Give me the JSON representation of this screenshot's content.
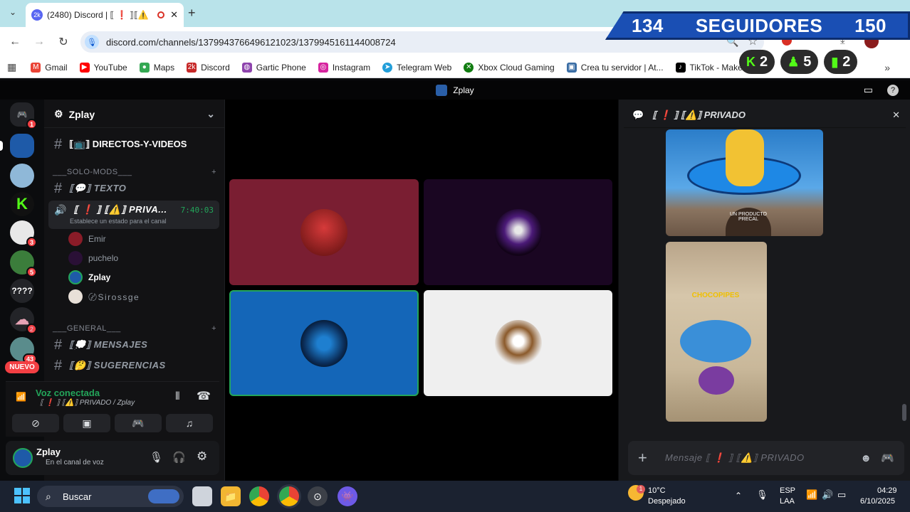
{
  "browser": {
    "tab_title": "(2480) Discord | ⟦ ❗ ⟧⟦⚠️",
    "url": "discord.com/channels/1379943766496121023/1379945161144008724",
    "bookmarks": [
      "Gmail",
      "YouTube",
      "Maps",
      "Discord",
      "Gartic Phone",
      "Instagram",
      "Telegram Web",
      "Xbox Cloud Gaming",
      "Crea tu servidor | At...",
      "TikTok - Make Your..."
    ]
  },
  "overlay": {
    "left_count": "134",
    "label": "SEGUIDORES",
    "right_count": "150",
    "badge1": "2",
    "badge2": "5",
    "badge3": "2"
  },
  "discord": {
    "window_title": "Zplay",
    "server_name": "Zplay",
    "rail": {
      "badges": [
        "1",
        "3",
        "5",
        "2",
        "43"
      ],
      "text_item": "????",
      "new_label": "NUEVO"
    },
    "channels": {
      "directos": "⟦📺⟧ DIRECTOS-Y-VIDEOS",
      "cat_solo": "___SOLO-MODS___",
      "texto": "⟦💬⟧ TEXTO",
      "voice_channel": "⟦ ❗ ⟧ ⟦⚠️⟧ PRIVA...",
      "voice_timer": "7:40:03",
      "status_hint": "Establece un estado para el canal",
      "users": [
        "Emir",
        "puchelo",
        "Zplay",
        "〄Sirossge"
      ],
      "cat_general": "___GENERAL___",
      "mensajes": "⟦💭⟧ MENSAJES",
      "sugerencias": "⟦🤔⟧ SUGERENCIAS"
    },
    "voice_panel": {
      "status": "Voz conectada",
      "location": "⟦ ❗ ⟧ ⟦⚠️⟧ PRIVADO / Zplay"
    },
    "user_panel": {
      "name": "Zplay",
      "status": "En el canal de voz"
    },
    "chat": {
      "header": "⟦ ❗ ⟧ ⟦⚠️⟧ PRIVADO",
      "img1_text": "UN PRODUCTO PRECAL",
      "img2_text": "CHOCOPIPES",
      "placeholder": "Mensaje ⟦ ❗ ⟧ ⟦⚠️⟧ PRIVADO"
    }
  },
  "taskbar": {
    "search": "Buscar",
    "weather_temp": "10°C",
    "weather_desc": "Despejado",
    "weather_badge": "1",
    "lang1": "ESP",
    "lang2": "LAA",
    "time": "04:29",
    "date": "6/10/2025"
  },
  "colors": {
    "tile_red": "#7a1e32",
    "tile_purple": "#1a0622",
    "tile_blue": "#1466b8",
    "tile_white": "#efefef",
    "voice_green": "#23a55a"
  }
}
